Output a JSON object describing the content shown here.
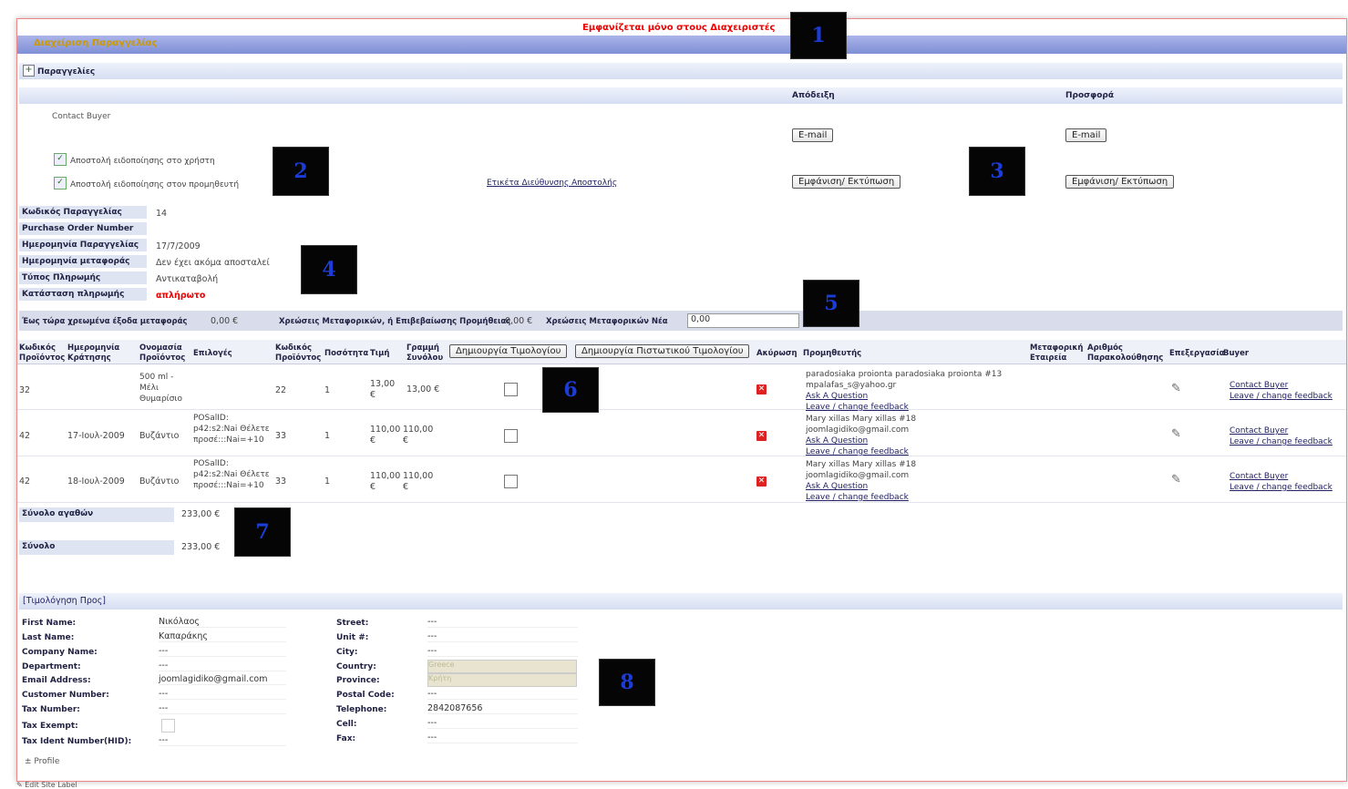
{
  "header": {
    "admin_note": "Εμφανίζεται μόνο στους Διαχειριστές",
    "band_title": "Διαχείριση Παραγγελίας",
    "orders_label": "Παραγγελίες"
  },
  "contact": {
    "col_view": "Απόδειξη",
    "col_seller": "Προσφορά",
    "contact_buyer": "Contact Buyer",
    "email_btn": "E-mail",
    "notify_user": "Αποστολή ειδοποίησης στο χρήστη",
    "notify_vendor": "Αποστολή ειδοποίησης στον προμηθευτή",
    "shipping_link": "Ετικέτα Διεύθυνσης Αποστολής",
    "print_btn": "Εμφάνιση/ Εκτύπωση"
  },
  "order_info": [
    {
      "label": "Κωδικός Παραγγελίας",
      "value": "14"
    },
    {
      "label": "Purchase Order Number",
      "value": ""
    },
    {
      "label": "Ημερομηνία Παραγγελίας",
      "value": "17/7/2009"
    },
    {
      "label": "Ημερομηνία μεταφοράς",
      "value": "Δεν έχει ακόμα αποσταλεί"
    },
    {
      "label": "Τύπος Πληρωμής",
      "value": "Αντικαταβολή"
    },
    {
      "label": "Κατάσταση πληρωμής",
      "value": "απλήρωτο"
    }
  ],
  "shipping_bar": {
    "paid_label": "Έως τώρα χρεωμένα έξοδα μεταφοράς",
    "paid_value": "0,00 €",
    "charge_label": "Χρεώσεις Μεταφορικών, ή Επιβεβαίωσης Προμήθειας",
    "charge_value": "0,00 €",
    "new_label": "Χρεώσεις Μεταφορικών Νέα",
    "new_value": "0,00"
  },
  "table": {
    "headers": [
      "Κωδικός Προϊόντος",
      "Ημερομηνία Κράτησης",
      "Ονομασία Προϊόντος",
      "Επιλογές",
      "Κωδικός Προϊόντος",
      "Ποσότητα",
      "Τιμή",
      "Γραμμή Συνόλου",
      "Ακύρωση",
      "Προμηθευτής",
      "Μεταφορική Εταιρεία",
      "Αριθμός Παρακολούθησης",
      "Επεξεργασία",
      "Buyer"
    ],
    "create_invoice": "Δημιουργία Τιμολογίου",
    "create_credit": "Δημιουργία Πιστωτικού Τιμολογίου",
    "rows": [
      {
        "code": "32",
        "date": "",
        "name": "500 ml - Μέλι Θυμαρίσιο",
        "options": "",
        "pcode": "22",
        "qty": "1",
        "price": "13,00 €",
        "total": "13,00 €",
        "vendor": [
          "paradosiaka proionta paradosiaka proionta #13",
          "mpalafas_s@yahoo.gr",
          "Ask A Question",
          "Leave / change feedback"
        ],
        "buyer": [
          "Contact Buyer",
          "Leave / change feedback"
        ]
      },
      {
        "code": "42",
        "date": "17-Ιουλ-2009",
        "name": "Βυζάντιο",
        "options": "POSalID: p42:s2:Nai Θέλετε προσέ:::Nai=+10",
        "pcode": "33",
        "qty": "1",
        "price": "110,00 €",
        "total": "110,00 €",
        "vendor": [
          "Mary xillas Mary xillas #18",
          "joomlagidiko@gmail.com",
          "Ask A Question",
          "Leave / change feedback"
        ],
        "buyer": [
          "Contact Buyer",
          "Leave / change feedback"
        ]
      },
      {
        "code": "42",
        "date": "18-Ιουλ-2009",
        "name": "Βυζάντιο",
        "options": "POSalID: p42:s2:Nai Θέλετε προσέ:::Nai=+10",
        "pcode": "33",
        "qty": "1",
        "price": "110,00 €",
        "total": "110,00 €",
        "vendor": [
          "Mary xillas Mary xillas #18",
          "joomlagidiko@gmail.com",
          "Ask A Question",
          "Leave / change feedback"
        ],
        "buyer": [
          "Contact Buyer",
          "Leave / change feedback"
        ]
      }
    ]
  },
  "totals": {
    "goods_label": "Σύνολο αγαθών",
    "goods_value": "233,00 €",
    "total_label": "Σύνολο",
    "total_value": "233,00 €"
  },
  "billing": {
    "title": "[Τιμολόγηση Προς]",
    "left": [
      {
        "label": "First Name:",
        "value": "Νικόλαος"
      },
      {
        "label": "Last Name:",
        "value": "Καπαράκης"
      },
      {
        "label": "Company Name:",
        "value": "---"
      },
      {
        "label": "Department:",
        "value": "---"
      },
      {
        "label": "Email Address:",
        "value": "joomlagidiko@gmail.com"
      },
      {
        "label": "Customer Number:",
        "value": "---"
      },
      {
        "label": "Tax Number:",
        "value": "---"
      },
      {
        "label": "Tax Exempt:",
        "value": ""
      },
      {
        "label": "Tax Ident Number(HID):",
        "value": "---"
      }
    ],
    "right": [
      {
        "label": "Street:",
        "value": "---"
      },
      {
        "label": "Unit #:",
        "value": "---"
      },
      {
        "label": "City:",
        "value": "---"
      },
      {
        "label": "Country:",
        "value": "Greece"
      },
      {
        "label": "Province:",
        "value": "Κρήτη"
      },
      {
        "label": "Postal Code:",
        "value": "---"
      },
      {
        "label": "Telephone:",
        "value": "2842087656"
      },
      {
        "label": "Cell:",
        "value": "---"
      },
      {
        "label": "Fax:",
        "value": "---"
      }
    ],
    "profile_link": "Profile"
  },
  "footer": {
    "edit_label": "Edit Site Label"
  },
  "markers": [
    "1",
    "2",
    "3",
    "4",
    "5",
    "6",
    "7",
    "8"
  ]
}
